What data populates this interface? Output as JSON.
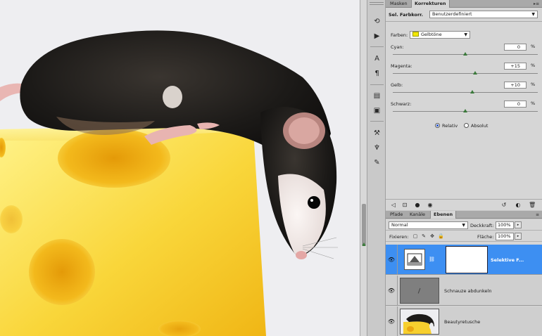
{
  "panels": {
    "corrections_tabs": [
      "Masken",
      "Korrekturen"
    ],
    "corrections_active_tab": "Korrekturen",
    "panel_menu_icon": "panel-menu-icon",
    "corrections": {
      "title": "Sel. Farbkorr.",
      "preset": "Benutzerdefiniert",
      "colors_label": "Farben:",
      "colors_value": "Gelbtöne",
      "colors_swatch": "#f3e800",
      "sliders": [
        {
          "label": "Cyan:",
          "value": "0",
          "unit": "%",
          "position": 0.5
        },
        {
          "label": "Magenta:",
          "value": "+15",
          "unit": "%",
          "position": 0.57
        },
        {
          "label": "Gelb:",
          "value": "+10",
          "unit": "%",
          "position": 0.55
        },
        {
          "label": "Schwarz:",
          "value": "0",
          "unit": "%",
          "position": 0.5
        }
      ],
      "method_options": [
        "Relativ",
        "Absolut"
      ],
      "method_selected": "Relativ"
    },
    "layers_tabs": [
      "Pfade",
      "Kanäle",
      "Ebenen"
    ],
    "layers_active_tab": "Ebenen",
    "layers": {
      "blend_mode": "Normal",
      "opacity_label": "Deckkraft:",
      "opacity": "100%",
      "lock_label": "Fixieren:",
      "fill_label": "Fläche:",
      "fill": "100%",
      "items": [
        {
          "name": "Selektive F...",
          "selected": true,
          "type": "adjustment"
        },
        {
          "name": "Schnauze abdunkeln",
          "selected": false,
          "type": "gray"
        },
        {
          "name": "Beautyretusche",
          "selected": false,
          "type": "photo"
        }
      ]
    }
  },
  "colors": {
    "selection": "#3d8ff2",
    "panel": "#d6d6d6",
    "cheese": "#f5c81e"
  }
}
